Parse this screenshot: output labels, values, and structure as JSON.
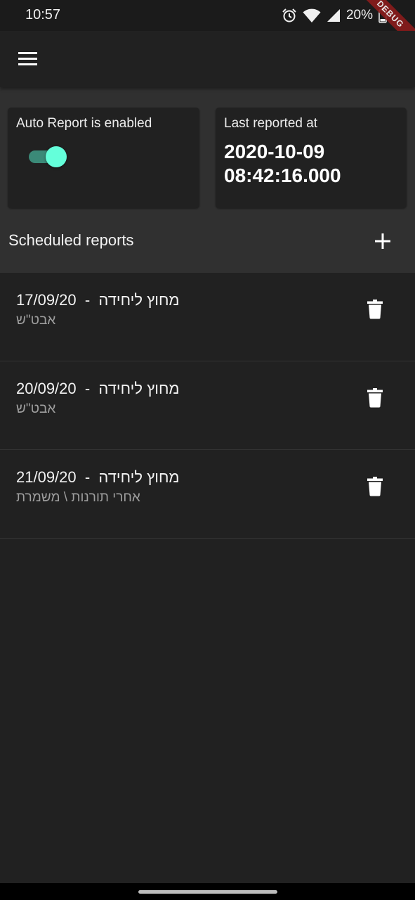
{
  "status_bar": {
    "time": "10:57",
    "battery": "20%",
    "icons": [
      "alarm-icon",
      "wifi-icon",
      "signal-icon",
      "battery-icon"
    ]
  },
  "debug_banner": "DEBUG",
  "app_bar": {
    "menu_icon": "menu-icon"
  },
  "auto_report": {
    "label": "Auto Report is enabled",
    "enabled": true
  },
  "last_reported": {
    "label": "Last reported at",
    "value": "2020-10-09 08:42:16.000"
  },
  "scheduled": {
    "title": "Scheduled reports",
    "add_icon": "plus-icon"
  },
  "reports": [
    {
      "title": "17/09/20  -  מחוץ ליחידה",
      "subtitle": "אבט\"ש"
    },
    {
      "title": "20/09/20  -  מחוץ ליחידה",
      "subtitle": "אבט\"ש"
    },
    {
      "title": "21/09/20  -  מחוץ ליחידה",
      "subtitle": "אחרי תורנות \\ משמרת"
    }
  ],
  "colors": {
    "background": "#212121",
    "section": "#303030",
    "accent": "#64ffda",
    "track": "#3b8a78",
    "debug": "#8a1c1c"
  }
}
